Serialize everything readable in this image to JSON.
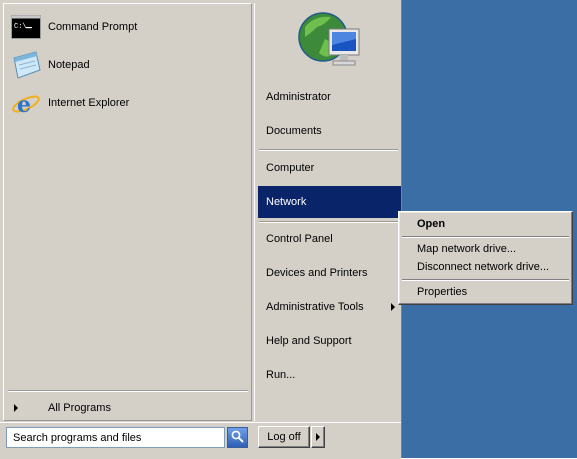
{
  "left_pane": {
    "pinned": [
      {
        "label": "Command Prompt",
        "icon": "command-prompt-icon"
      },
      {
        "label": "Notepad",
        "icon": "notepad-icon"
      },
      {
        "label": "Internet Explorer",
        "icon": "internet-explorer-icon"
      }
    ],
    "all_programs_label": "All Programs"
  },
  "right_pane": {
    "user_picture_icon": "globe-monitor-icon",
    "items": [
      {
        "label": "Administrator"
      },
      {
        "label": "Documents"
      },
      {
        "label": "Computer"
      },
      {
        "label": "Network"
      },
      {
        "label": "Control Panel"
      },
      {
        "label": "Devices and Printers"
      },
      {
        "label": "Administrative Tools"
      },
      {
        "label": "Help and Support"
      },
      {
        "label": "Run..."
      }
    ],
    "selected_item": "Network"
  },
  "search": {
    "placeholder": "Search programs and files"
  },
  "logoff": {
    "label": "Log off"
  },
  "context_menu": {
    "items": [
      {
        "label": "Open"
      },
      {
        "label": "Map network drive..."
      },
      {
        "label": "Disconnect network drive..."
      },
      {
        "label": "Properties"
      }
    ]
  },
  "colors": {
    "desktop": "#3a6ea5",
    "menu_face": "#d4d0c8",
    "selection": "#0a246a"
  }
}
